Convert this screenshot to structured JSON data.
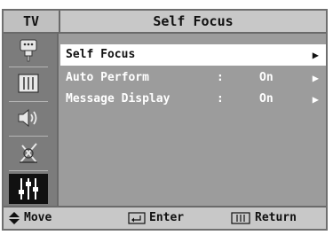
{
  "header": {
    "tv_label": "TV",
    "title": "Self Focus"
  },
  "sidebar": {
    "icons": [
      {
        "name": "input-source-icon",
        "active": false
      },
      {
        "name": "picture-icon",
        "active": false
      },
      {
        "name": "sound-icon",
        "active": false
      },
      {
        "name": "channel-antenna-icon",
        "active": false
      },
      {
        "name": "setup-sliders-icon",
        "active": true
      }
    ]
  },
  "menu": {
    "items": [
      {
        "label": "Self Focus",
        "colon": "",
        "value": "",
        "arrow": "▶",
        "selected": true
      },
      {
        "label": "Auto Perform",
        "colon": ":",
        "value": "On",
        "arrow": "▶",
        "selected": false
      },
      {
        "label": "Message Display",
        "colon": ":",
        "value": "On",
        "arrow": "▶",
        "selected": false
      }
    ]
  },
  "footer": {
    "move_label": "Move",
    "enter_label": "Enter",
    "return_label": "Return"
  },
  "colors": {
    "panel": "#9c9c9c",
    "bar": "#c8c8c8",
    "sidebar": "#7c7c7c",
    "highlight": "#ffffff"
  }
}
